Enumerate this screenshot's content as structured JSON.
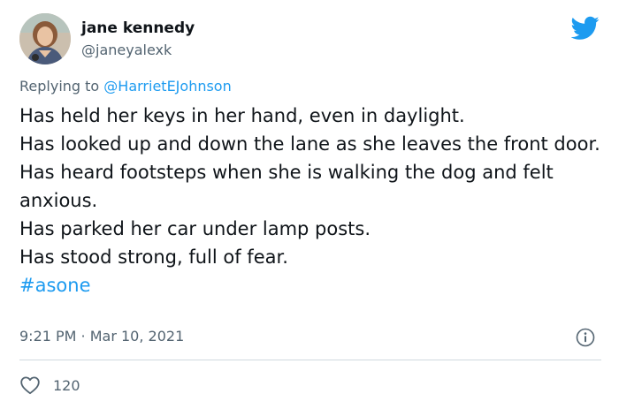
{
  "author": {
    "display_name": "jane kennedy",
    "handle": "@janeyalexk"
  },
  "reply": {
    "prefix": "Replying to",
    "mention": "@HarrietEJohnson"
  },
  "tweet": {
    "lines": [
      "Has held her keys in her hand, even in daylight.",
      "Has looked up and down the lane as she leaves the front door.",
      "Has heard footsteps when she is walking the dog and felt anxious.",
      "Has parked her car under lamp posts.",
      "Has stood strong, full of fear."
    ],
    "hashtag": "#asone"
  },
  "meta": {
    "timestamp": "9:21 PM · Mar 10, 2021"
  },
  "stats": {
    "likes": "120"
  },
  "colors": {
    "accent": "#1d9bf0",
    "secondary_text": "#536471",
    "divider": "#cfd9de"
  },
  "icons": {
    "brand": "twitter-bird-icon",
    "info": "info-icon",
    "like": "heart-icon"
  }
}
